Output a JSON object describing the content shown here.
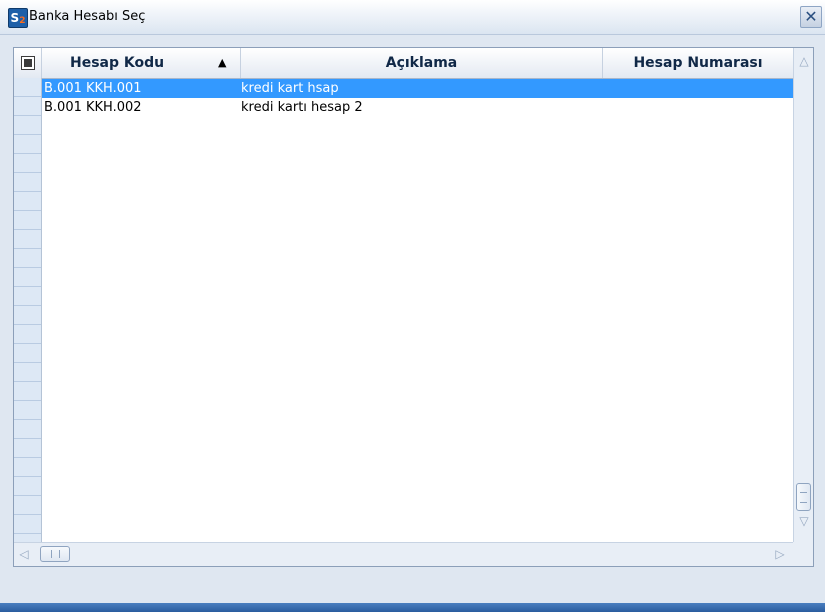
{
  "window": {
    "title": "Banka Hesabı Seç",
    "icon_label": "S",
    "icon_sub": "2",
    "close_label": "✕"
  },
  "grid": {
    "columns": [
      {
        "key": "code",
        "label": "Hesap Kodu",
        "sorted": "ascending"
      },
      {
        "key": "desc",
        "label": "Açıklama"
      },
      {
        "key": "number",
        "label": "Hesap Numarası"
      }
    ],
    "sort_indicator": "▲",
    "rows": [
      {
        "code": "B.001 KKH.001",
        "desc": "kredi kart hsap",
        "number": "",
        "selected": true
      },
      {
        "code": "B.001 KKH.002",
        "desc": "kredi kartı hesap 2",
        "number": "",
        "selected": false
      }
    ]
  },
  "scrollbars": {
    "up_arrow": "△",
    "down_arrow": "▽",
    "left_arrow": "◁",
    "right_arrow": "▷"
  },
  "colors": {
    "selection": "#3399ff",
    "header_text": "#102847"
  }
}
